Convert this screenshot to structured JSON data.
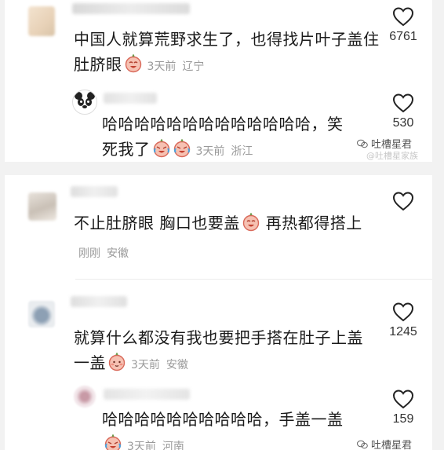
{
  "comments": [
    {
      "text": "中国人就算荒野求生了，也得找片叶子盖住肚脐眼",
      "emoji": "laughing-face-emoji",
      "time": "3天前",
      "location": "辽宁",
      "likes": "6761",
      "reply": {
        "text": "哈哈哈哈哈哈哈哈哈哈哈哈哈，笑死我了",
        "emoji": "crying-laughing-emoji",
        "time": "3天前",
        "location": "浙江",
        "likes": "530"
      }
    },
    {
      "text": "不止肚脐眼 胸口也要盖",
      "text_tail": "再热都得搭上",
      "emoji": "laughing-face-emoji",
      "time": "刚刚",
      "location": "安徽",
      "likes": ""
    },
    {
      "text": "就算什么都没有我也要把手搭在肚子上盖一盖",
      "emoji": "shy-face-emoji",
      "time": "3天前",
      "location": "安徽",
      "likes": "1245",
      "reply": {
        "text": "哈哈哈哈哈哈哈哈哈哈，手盖一盖",
        "emoji": "crying-laughing-emoji",
        "time": "3天前",
        "location": "河南",
        "likes": "159"
      }
    }
  ],
  "watermark": {
    "text": "吐槽星君",
    "sub": "@吐槽星家族"
  },
  "colors": {
    "text": "#1a1a1a",
    "meta": "#9a9a9a",
    "background": "#f2f2f2",
    "card": "#ffffff"
  }
}
